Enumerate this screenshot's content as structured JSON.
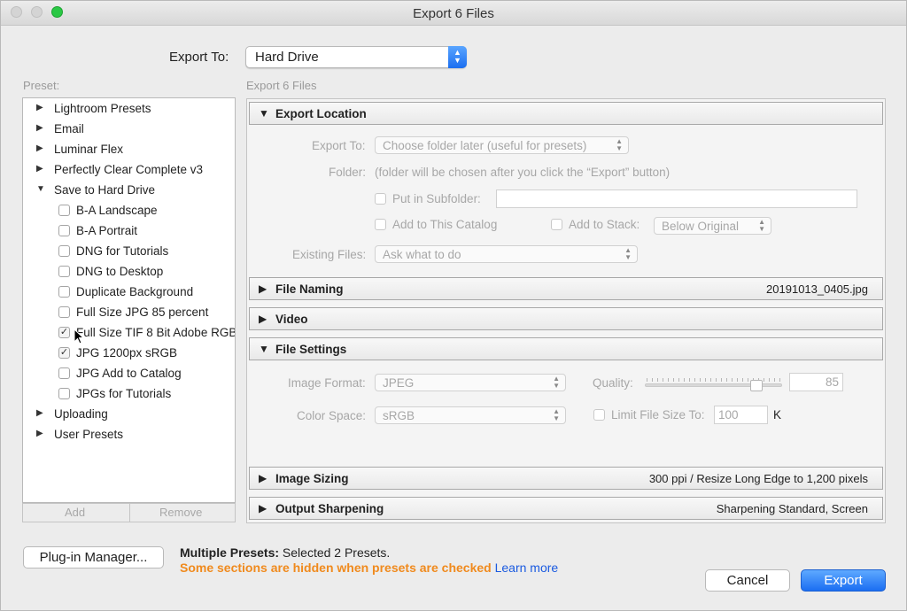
{
  "window": {
    "title": "Export 6 Files"
  },
  "export_to": {
    "label": "Export To:",
    "value": "Hard Drive"
  },
  "preset": {
    "label": "Preset:",
    "groups": [
      {
        "label": "Lightroom Presets",
        "expanded": false
      },
      {
        "label": "Email",
        "expanded": false
      },
      {
        "label": "Luminar Flex",
        "expanded": false
      },
      {
        "label": "Perfectly Clear Complete v3",
        "expanded": false
      },
      {
        "label": "Save to Hard Drive",
        "expanded": true
      },
      {
        "label": "Uploading",
        "expanded": false
      },
      {
        "label": "User Presets",
        "expanded": false
      }
    ],
    "children": [
      {
        "label": "B-A Landscape",
        "checked": false
      },
      {
        "label": "B-A Portrait",
        "checked": false
      },
      {
        "label": "DNG for Tutorials",
        "checked": false
      },
      {
        "label": "DNG to Desktop",
        "checked": false
      },
      {
        "label": "Duplicate Background",
        "checked": false
      },
      {
        "label": "Full Size JPG 85 percent",
        "checked": false
      },
      {
        "label": "Full Size TIF 8 Bit Adobe RGB",
        "checked": true
      },
      {
        "label": "JPG 1200px sRGB",
        "checked": true
      },
      {
        "label": "JPG Add to Catalog",
        "checked": false
      },
      {
        "label": "JPGs for Tutorials",
        "checked": false
      }
    ],
    "add_label": "Add",
    "remove_label": "Remove",
    "arrow_collapsed": "▶",
    "arrow_expanded": "▼",
    "check_mark": "✓"
  },
  "panel": {
    "heading": "Export 6 Files",
    "export_location": {
      "name": "Export Location",
      "export_to_label": "Export To:",
      "export_to_value": "Choose folder later (useful for presets)",
      "folder_label": "Folder:",
      "folder_note": "(folder will be chosen after you click the “Export” button)",
      "subfolder_label": "Put in Subfolder:",
      "add_catalog_label": "Add to This Catalog",
      "add_stack_label": "Add to Stack:",
      "stack_value": "Below Original",
      "existing_label": "Existing Files:",
      "existing_value": "Ask what to do"
    },
    "file_naming": {
      "name": "File Naming",
      "summary": "20191013_0405.jpg"
    },
    "video": {
      "name": "Video"
    },
    "file_settings": {
      "name": "File Settings",
      "format_label": "Image Format:",
      "format_value": "JPEG",
      "quality_label": "Quality:",
      "quality_value": "85",
      "colorspace_label": "Color Space:",
      "colorspace_value": "sRGB",
      "limit_label": "Limit File Size To:",
      "limit_value": "100",
      "limit_unit": "K"
    },
    "image_sizing": {
      "name": "Image Sizing",
      "summary": "300 ppi / Resize Long Edge to 1,200 pixels"
    },
    "output_sharpening": {
      "name": "Output Sharpening",
      "summary": "Sharpening Standard, Screen"
    }
  },
  "footer": {
    "plugin_label": "Plug-in Manager...",
    "multi_bold": "Multiple Presets:",
    "multi_text": " Selected 2 Presets.",
    "warning": "Some sections are hidden when presets are checked",
    "learn_more": "Learn more",
    "cancel_label": "Cancel",
    "export_label": "Export"
  },
  "colors": {
    "accent": "#1b6ef2",
    "warning": "#f08a1d",
    "link": "#1a5ae0"
  }
}
